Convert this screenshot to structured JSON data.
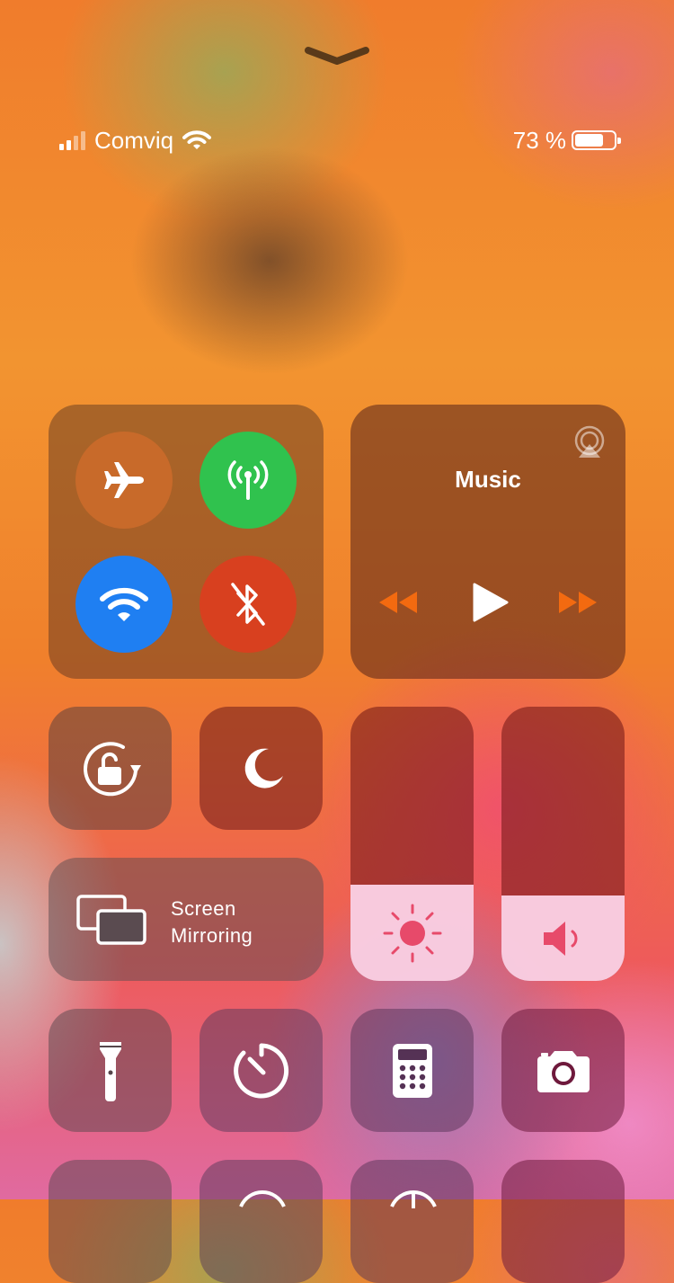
{
  "status_bar": {
    "carrier": "Comviq",
    "battery_text": "73 %",
    "battery_level": 0.73,
    "signal_bars_active": 2,
    "signal_bars_total": 4
  },
  "music": {
    "title": "Music"
  },
  "screen_mirroring": {
    "line1": "Screen",
    "line2": "Mirroring"
  },
  "sliders": {
    "brightness_level": 0.35,
    "volume_level": 0.31
  },
  "colors": {
    "cellular_on": "#30c24e",
    "wifi_on": "#1f7ff2",
    "bluetooth_off": "#d8401f",
    "airplane_off": "#c86a2a",
    "media_controls": "#f36a10"
  },
  "icons": [
    "chevron-down-icon",
    "signal-icon",
    "wifi-icon",
    "battery-icon",
    "airplane-icon",
    "cellular-icon",
    "bluetooth-icon",
    "airplay-icon",
    "rewind-icon",
    "play-icon",
    "fast-forward-icon",
    "orientation-lock-icon",
    "moon-icon",
    "screen-mirroring-icon",
    "sun-icon",
    "speaker-icon",
    "flashlight-icon",
    "timer-icon",
    "calculator-icon",
    "camera-icon"
  ]
}
